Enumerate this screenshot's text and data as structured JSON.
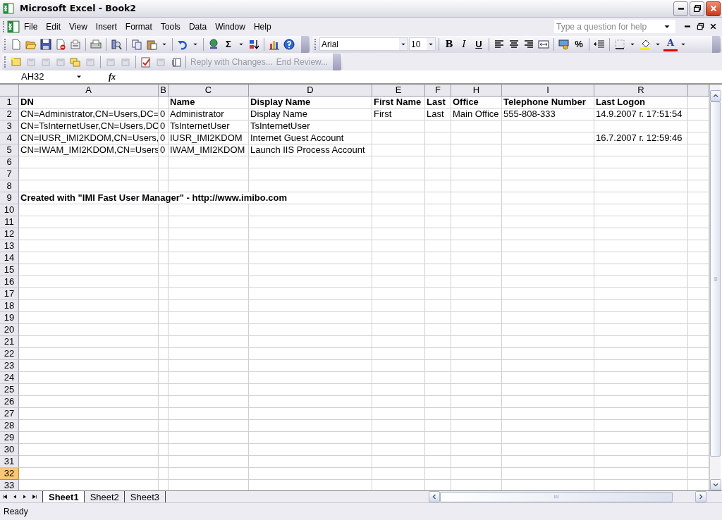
{
  "window": {
    "title": "Microsoft Excel - Book2"
  },
  "menu_bar": {
    "items": [
      "File",
      "Edit",
      "View",
      "Insert",
      "Format",
      "Tools",
      "Data",
      "Window",
      "Help"
    ],
    "help_box": {
      "placeholder": "Type a question for help"
    }
  },
  "standard_toolbar": {
    "sum_label": "Σ"
  },
  "formatting_toolbar": {
    "font": "Arial",
    "size": "10",
    "bold": "B",
    "italic": "I",
    "underline": "U",
    "percent": "%",
    "font_color": "A"
  },
  "reviewing_toolbar": {
    "reply": "Reply with Changes...",
    "end_review": "End Review..."
  },
  "formula_bar": {
    "name_box": "AH32",
    "function_label": "fx"
  },
  "sheet": {
    "columns": [
      "A",
      "B",
      "C",
      "D",
      "E",
      "F",
      "H",
      "I",
      "R"
    ],
    "rows": [
      {
        "number": "1",
        "selected": false,
        "bold": true,
        "cells": [
          "DN",
          null,
          "Name",
          "Display Name",
          "First Name",
          "Last",
          "Office",
          "Telephone Number",
          "Last Logon"
        ]
      },
      {
        "number": "2",
        "selected": false,
        "bold": false,
        "cells": [
          "CN=Administrator,CN=Users,DC=",
          "0",
          "Administrator",
          "Display Name",
          "First",
          "Last",
          "Main Office",
          "555-808-333",
          "14.9.2007 г. 17:51:54"
        ]
      },
      {
        "number": "3",
        "selected": false,
        "bold": false,
        "cells": [
          "CN=TsInternetUser,CN=Users,DC",
          "0",
          "TsInternetUser",
          "TsInternetUser",
          null,
          null,
          null,
          null,
          null
        ]
      },
      {
        "number": "4",
        "selected": false,
        "bold": false,
        "cells": [
          "CN=IUSR_IMI2KDOM,CN=Users,",
          "0",
          "IUSR_IMI2KDOM",
          "Internet Guest Account",
          null,
          null,
          null,
          null,
          "16.7.2007 г. 12:59:46"
        ]
      },
      {
        "number": "5",
        "selected": false,
        "bold": false,
        "cells": [
          "CN=IWAM_IMI2KDOM,CN=Users",
          "0",
          "IWAM_IMI2KDOM",
          "Launch IIS Process Account",
          null,
          null,
          null,
          null,
          null
        ]
      },
      {
        "number": "6",
        "selected": false
      },
      {
        "number": "7",
        "selected": false
      },
      {
        "number": "8",
        "selected": false
      },
      {
        "number": "9",
        "selected": false,
        "bold": true,
        "cells": [
          "Created with \"IMI Fast User Manager\" -  http://www.imibo.com"
        ]
      },
      {
        "number": "10",
        "selected": false
      },
      {
        "number": "11",
        "selected": false
      },
      {
        "number": "12",
        "selected": false
      },
      {
        "number": "13",
        "selected": false
      },
      {
        "number": "14",
        "selected": false
      },
      {
        "number": "15",
        "selected": false
      },
      {
        "number": "16",
        "selected": false
      },
      {
        "number": "17",
        "selected": false
      },
      {
        "number": "18",
        "selected": false
      },
      {
        "number": "19",
        "selected": false
      },
      {
        "number": "20",
        "selected": false
      },
      {
        "number": "21",
        "selected": false
      },
      {
        "number": "22",
        "selected": false
      },
      {
        "number": "23",
        "selected": false
      },
      {
        "number": "24",
        "selected": false
      },
      {
        "number": "25",
        "selected": false
      },
      {
        "number": "26",
        "selected": false
      },
      {
        "number": "27",
        "selected": false
      },
      {
        "number": "28",
        "selected": false
      },
      {
        "number": "29",
        "selected": false
      },
      {
        "number": "30",
        "selected": false
      },
      {
        "number": "31",
        "selected": false
      },
      {
        "number": "32",
        "selected": true
      },
      {
        "number": "33",
        "selected": false
      }
    ]
  },
  "sheet_tabs": [
    {
      "label": "Sheet1",
      "selected": true
    },
    {
      "label": "Sheet2",
      "selected": false
    },
    {
      "label": "Sheet3",
      "selected": false
    }
  ],
  "status_bar": {
    "text": "Ready"
  }
}
